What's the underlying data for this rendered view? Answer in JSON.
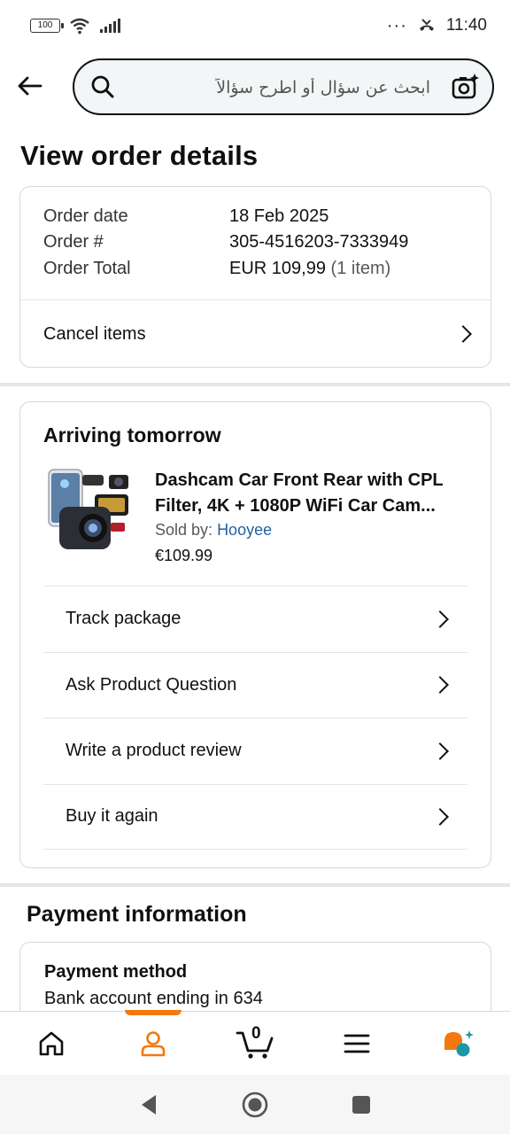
{
  "status_bar": {
    "battery": "100",
    "time": "11:40",
    "dots": "···"
  },
  "search": {
    "placeholder": "ابحث عن سؤال أو اطرح سؤالاً"
  },
  "page_title": "View order details",
  "order_summary": {
    "order_date_label": "Order date",
    "order_date_value": "18 Feb 2025",
    "order_number_label": "Order #",
    "order_number_value": "305-4516203-7333949",
    "order_total_label": "Order Total",
    "order_total_value": "EUR 109,99",
    "order_total_items": "(1 item)",
    "cancel_label": "Cancel items"
  },
  "shipment": {
    "status": "Arriving tomorrow",
    "product": {
      "title": "Dashcam Car Front Rear with CPL Filter, 4K + 1080P WiFi Car Cam...",
      "sold_by_label": "Sold by:",
      "seller": "Hooyee",
      "price": "€109.99"
    },
    "actions": [
      {
        "label": "Track package"
      },
      {
        "label": "Ask Product Question"
      },
      {
        "label": "Write a product review"
      },
      {
        "label": "Buy it again"
      }
    ]
  },
  "payment": {
    "section_title": "Payment information",
    "method_label": "Payment method",
    "method_value": "Bank account ending in 634"
  },
  "bottom_nav": {
    "items": [
      "home-icon",
      "account-icon",
      "cart-icon",
      "menu-icon",
      "rufus-icon"
    ],
    "cart_count": "0",
    "active": "account-icon",
    "accent": "#f3780f"
  },
  "colors": {
    "link": "#2162a1",
    "text": "#0f1111",
    "secondary": "#565959",
    "border": "#d5d9d9"
  }
}
